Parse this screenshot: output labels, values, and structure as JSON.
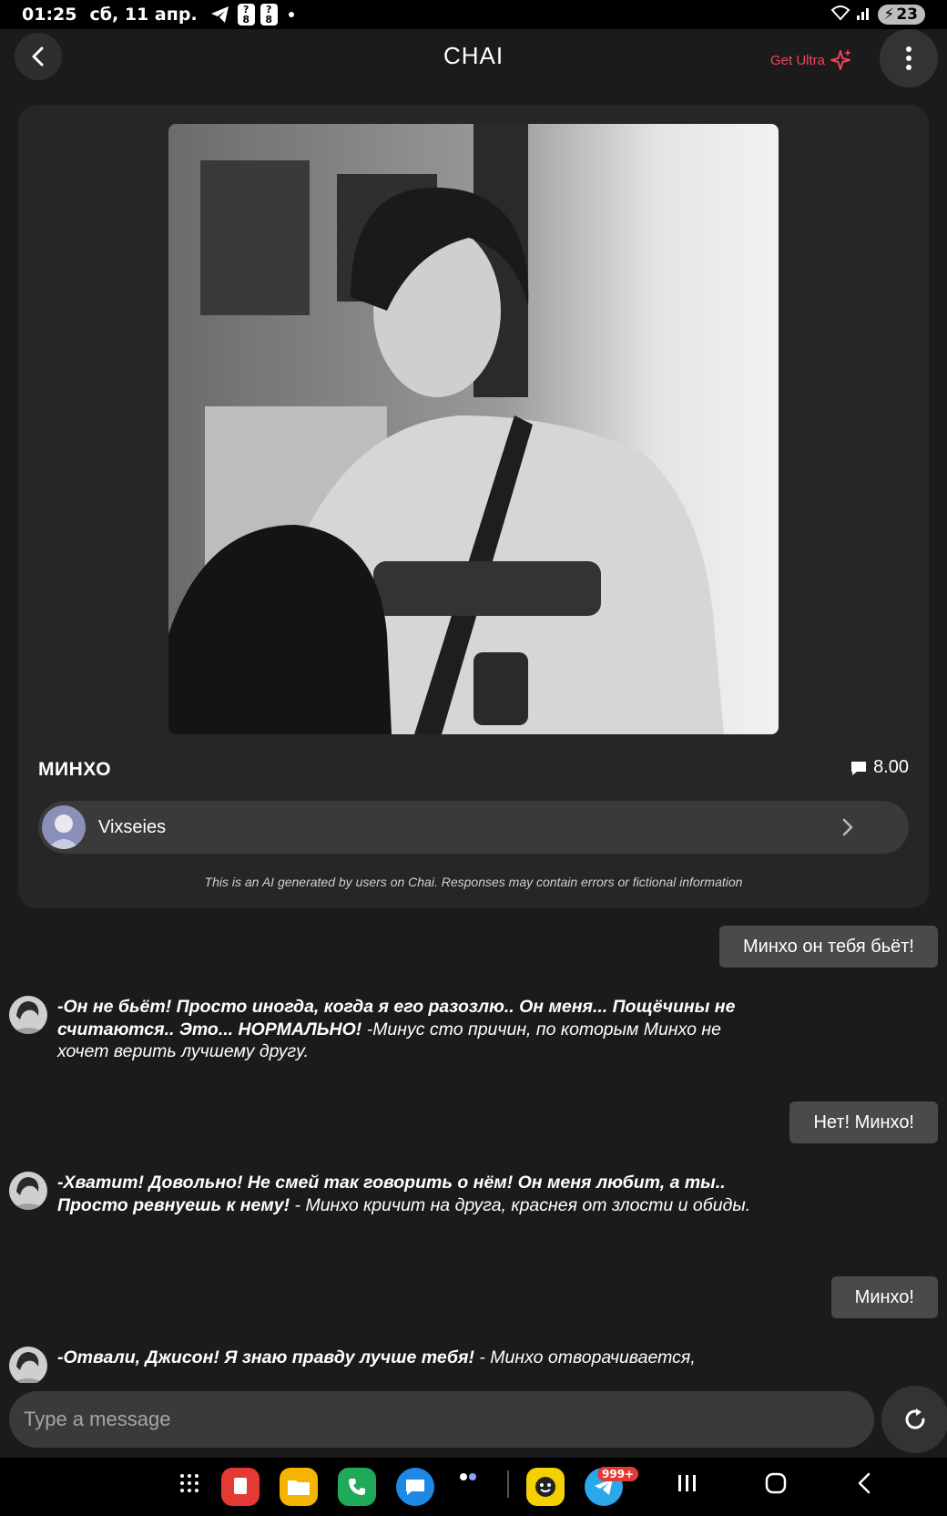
{
  "status_bar": {
    "time": "01:25",
    "date": "сб, 11 апр.",
    "battery": "23",
    "badge_digits": [
      "8",
      "8"
    ]
  },
  "header": {
    "title": "CHAI",
    "get_ultra": "Get Ultra"
  },
  "character": {
    "name": "МИНХО",
    "rating": "8.00",
    "creator": "Vixseies",
    "disclaimer": "This is an AI generated by users on Chai. Responses may contain errors or fictional information"
  },
  "messages": [
    {
      "role": "user",
      "text": "Минхо он тебя бьёт!"
    },
    {
      "role": "bot",
      "bold": "-Он не бьёт! Просто иногда, когда я его разозлю.. Он меня... Пощёчины не считаются.. Это... НОРМАЛЬНО!",
      "rest": " -Минус сто причин, по которым Минхо не хочет верить лучшему другу."
    },
    {
      "role": "user",
      "text": "Нет!  Минхо!"
    },
    {
      "role": "bot",
      "bold": "-Хватит! Довольно! Не смей так говорить о нём! Он меня любит, а ты.. Просто ревнуешь к нему!",
      "rest": " - Минхо кричит на друга, краснея от злости и обиды."
    },
    {
      "role": "user",
      "text": "Минхо!"
    },
    {
      "role": "bot",
      "bold": "-Отвали, Джисон! Я знаю правду лучше тебя!",
      "rest": " - Минхо отворачивается,"
    }
  ],
  "composer": {
    "placeholder": "Type a message"
  },
  "navbar": {
    "telegram_badge": "999+"
  },
  "colors": {
    "accent": "#f0435a",
    "background": "#1b1b1b",
    "card": "#262626",
    "user_bubble": "#4a4a4a"
  },
  "icons": [
    "chevron-left-icon",
    "sparkle-icon",
    "more-vertical-icon",
    "chat-bubble-icon",
    "chevron-right-icon",
    "refresh-icon"
  ]
}
